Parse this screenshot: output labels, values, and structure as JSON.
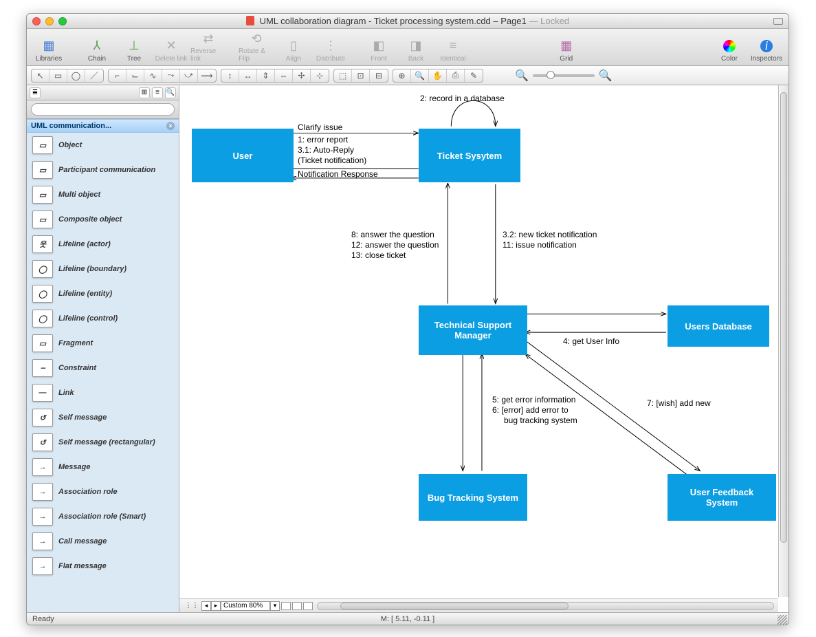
{
  "window": {
    "title_doc": "UML collaboration diagram - Ticket processing system.cdd",
    "title_page": "Page1",
    "title_lock": "Locked"
  },
  "toolbar": {
    "libraries": "Libraries",
    "chain": "Chain",
    "tree": "Tree",
    "delete_link": "Delete link",
    "reverse_link": "Reverse link",
    "rotate_flip": "Rotate & Flip",
    "align": "Align",
    "distribute": "Distribute",
    "front": "Front",
    "back": "Back",
    "identical": "Identical",
    "grid": "Grid",
    "color": "Color",
    "inspectors": "Inspectors"
  },
  "sidebar": {
    "category": "UML communication...",
    "search_placeholder": "",
    "items": [
      "Object",
      "Participant communication",
      "Multi object",
      "Composite object",
      "Lifeline (actor)",
      "Lifeline (boundary)",
      "Lifeline (entity)",
      "Lifeline (control)",
      "Fragment",
      "Constraint",
      "Link",
      "Self message",
      "Self message (rectangular)",
      "Message",
      "Association role",
      "Association role (Smart)",
      "Call message",
      "Flat message"
    ]
  },
  "diagram": {
    "nodes": {
      "user": "User",
      "ticket": "Ticket Sysytem",
      "tsm": "Technical Support Manager",
      "usersdb": "Users Database",
      "bug": "Bug Tracking System",
      "feedback": "User Feedback System"
    },
    "labels": {
      "clarify": "Clarify issue",
      "l1": "1: error report",
      "l31": "3.1: Auto-Reply",
      "l31b": "(Ticket notification)",
      "notif": "Notification Response",
      "rec": "2: record in a database",
      "l8": "8: answer the question",
      "l12": "12: answer the question",
      "l13": "13: close ticket",
      "l32": "3.2: new ticket notification",
      "l11": "11: issue notification",
      "l4": "4: get User Info",
      "l5": "5: get error information",
      "l6a": "6: [error] add error to",
      "l6b": "bug tracking system",
      "l7": "7: [wish] add new"
    }
  },
  "zoom": {
    "label": "Custom 80%"
  },
  "status": {
    "ready": "Ready",
    "coords": "M: [ 5.11, -0.11 ]"
  }
}
